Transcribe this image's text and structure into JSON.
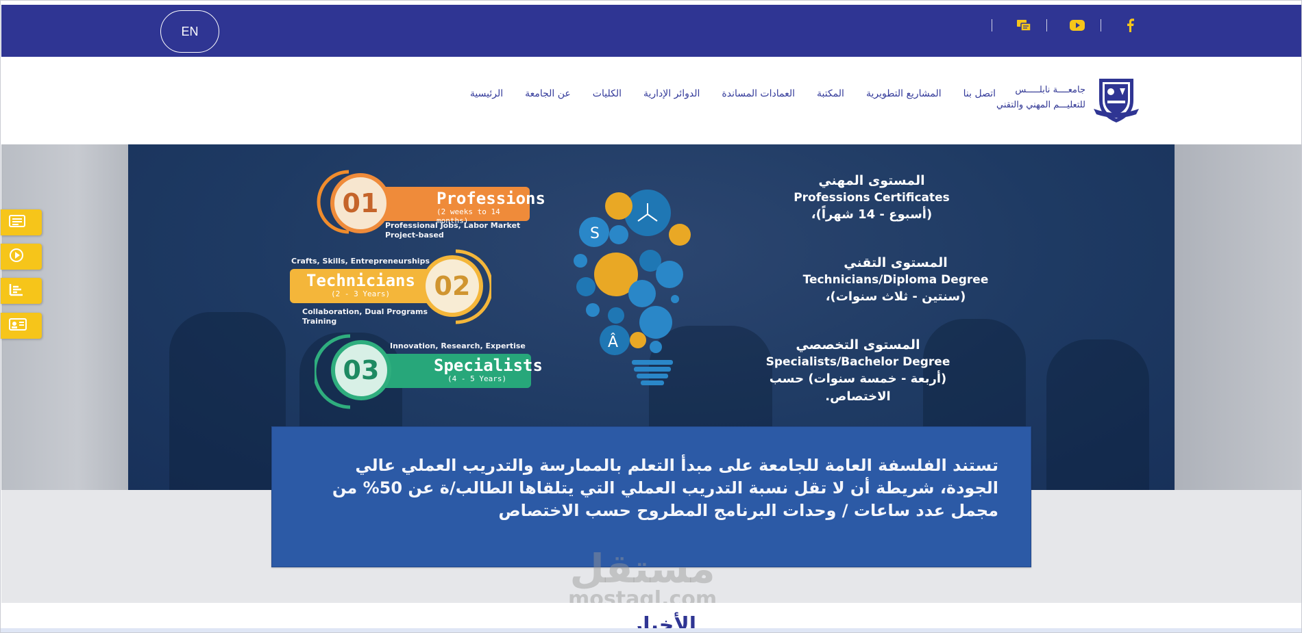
{
  "topbar": {
    "lang_label": "EN",
    "social_icons": [
      "facebook-icon",
      "youtube-icon",
      "mail-card-icon"
    ],
    "colors": {
      "bar": "#2f3593",
      "icon": "#f6c51a",
      "facebook": "#f6c51a"
    }
  },
  "header": {
    "logo_line1": "جامعــــة نابلـــــس",
    "logo_line2": "للتعليـــم المهني والتقني",
    "nav": [
      "الرئيسية",
      "عن الجامعة",
      "الكليات",
      "الدوائر الإدارية",
      "العمادات المساندة",
      "المكتبة",
      "المشاريع التطويرية",
      "اتصل بنا"
    ]
  },
  "side_buttons": [
    "news-icon",
    "play-icon",
    "list-chart-icon",
    "id-card-icon"
  ],
  "hero": {
    "levels": [
      {
        "num": "01",
        "title": "Professions",
        "sub": "(2 weeks to 14 months)",
        "note": "Professional Jobs, Labor Market Project-based"
      },
      {
        "num": "02",
        "title": "Technicians",
        "sub": "(2 - 3 Years)",
        "note_top": "Crafts, Skills, Entrepreneurships",
        "note": "Collaboration, Dual Programs Training"
      },
      {
        "num": "03",
        "title": "Specialists",
        "sub": "(4 - 5 Years)",
        "note_top": "Innovation, Research, Expertise"
      }
    ],
    "right_levels": [
      {
        "ar_title": "المستوى المهني",
        "en_title": "Professions Certificates",
        "ar_sub": "(أسبوع - 14 شهراً)،"
      },
      {
        "ar_title": "المستوى التقني",
        "en_title": "Technicians/Diploma Degree",
        "ar_sub": "(سنتين - ثلاث سنوات)،"
      },
      {
        "ar_title": "المستوى التخصصي",
        "en_title": "Specialists/Bachelor Degree",
        "ar_sub": "(أربعة - خمسة سنوات) حسب",
        "ar_sub2": "الاختصاص."
      }
    ],
    "philosophy": "تستند الفلسفة العامة للجامعة على مبدأ التعلم بالممارسة والتدريب العملي عالي الجودة، شريطة أن لا تقل نسبة التدريب العملي التي يتلقاها الطالب/ة عن 50% من مجمل عدد ساعات / وحدات البرنامج المطروح حسب الاختصاص"
  },
  "section_heading": "الأخبار",
  "watermark": {
    "ar": "مستقل",
    "en": "mostaql.com"
  }
}
